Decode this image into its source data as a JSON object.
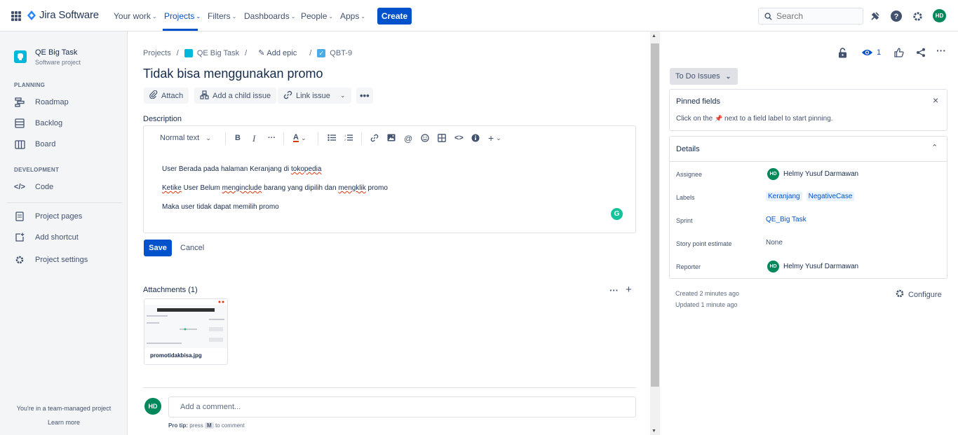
{
  "topnav": {
    "app_name": "Jira Software",
    "items": [
      {
        "label": "Your work"
      },
      {
        "label": "Projects"
      },
      {
        "label": "Filters"
      },
      {
        "label": "Dashboards"
      },
      {
        "label": "People"
      },
      {
        "label": "Apps"
      }
    ],
    "create_label": "Create",
    "search_placeholder": "Search",
    "user_initials": "HD"
  },
  "sidebar": {
    "project_name": "QE Big Task",
    "project_type": "Software project",
    "planning_heading": "PLANNING",
    "planning_items": [
      {
        "label": "Roadmap",
        "icon": "roadmap-icon"
      },
      {
        "label": "Backlog",
        "icon": "backlog-icon"
      },
      {
        "label": "Board",
        "icon": "board-icon"
      }
    ],
    "development_heading": "DEVELOPMENT",
    "development_items": [
      {
        "label": "Code",
        "icon": "code-icon"
      }
    ],
    "other_items": [
      {
        "label": "Project pages",
        "icon": "pages-icon"
      },
      {
        "label": "Add shortcut",
        "icon": "add-shortcut-icon"
      },
      {
        "label": "Project settings",
        "icon": "gear-icon"
      }
    ],
    "footer_text": "You're in a team-managed project",
    "learn_more": "Learn more"
  },
  "issue": {
    "breadcrumbs": {
      "projects": "Projects",
      "project": "QE Big Task",
      "epic": "Add epic",
      "key": "QBT-9"
    },
    "title": "Tidak bisa menggunakan promo",
    "actions": {
      "attach": "Attach",
      "child": "Add a child issue",
      "link": "Link issue"
    },
    "description_label": "Description",
    "editor": {
      "text_style": "Normal text",
      "lines": [
        {
          "before": "User Berada pada halaman Keranjang di ",
          "flagged": "tokopedia",
          "after": ""
        },
        {
          "flagged1": "Ketike",
          "middle": " User Belum ",
          "flagged2": "menginclude",
          "middle2": " barang yang dipilih dan ",
          "flagged3": "mengklik",
          "after": " promo"
        },
        {
          "text": "Maka user tidak dapat memilih promo"
        }
      ],
      "grammarly_letter": "G"
    },
    "save_label": "Save",
    "cancel_label": "Cancel",
    "attachments_title": "Attachments (1)",
    "attachment_name": "promotidakbisa.jpg",
    "comment_placeholder": "Add a comment...",
    "protip_label": "Pro tip:",
    "protip_press": "press",
    "protip_key": "M",
    "protip_tail": "to comment"
  },
  "right_panel": {
    "watch_count": "1",
    "status": "To Do Issues",
    "pinned": {
      "title": "Pinned fields",
      "text_before": "Click on the",
      "text_after": "next to a field label to start pinning."
    },
    "details": {
      "title": "Details",
      "assignee_label": "Assignee",
      "assignee": "Helmy Yusuf Darmawan",
      "assignee_initials": "HD",
      "labels_label": "Labels",
      "labels": [
        "Keranjang",
        "NegativeCase"
      ],
      "sprint_label": "Sprint",
      "sprint": "QE_Big Task",
      "story_label": "Story point estimate",
      "story_value": "None",
      "reporter_label": "Reporter",
      "reporter": "Helmy Yusuf Darmawan",
      "reporter_initials": "HD"
    },
    "created": "Created 2 minutes ago",
    "updated": "Updated 1 minute ago",
    "configure": "Configure"
  },
  "colors": {
    "brand": "#0052cc",
    "avatar": "#00875a",
    "grammarly": "#15c39a"
  }
}
